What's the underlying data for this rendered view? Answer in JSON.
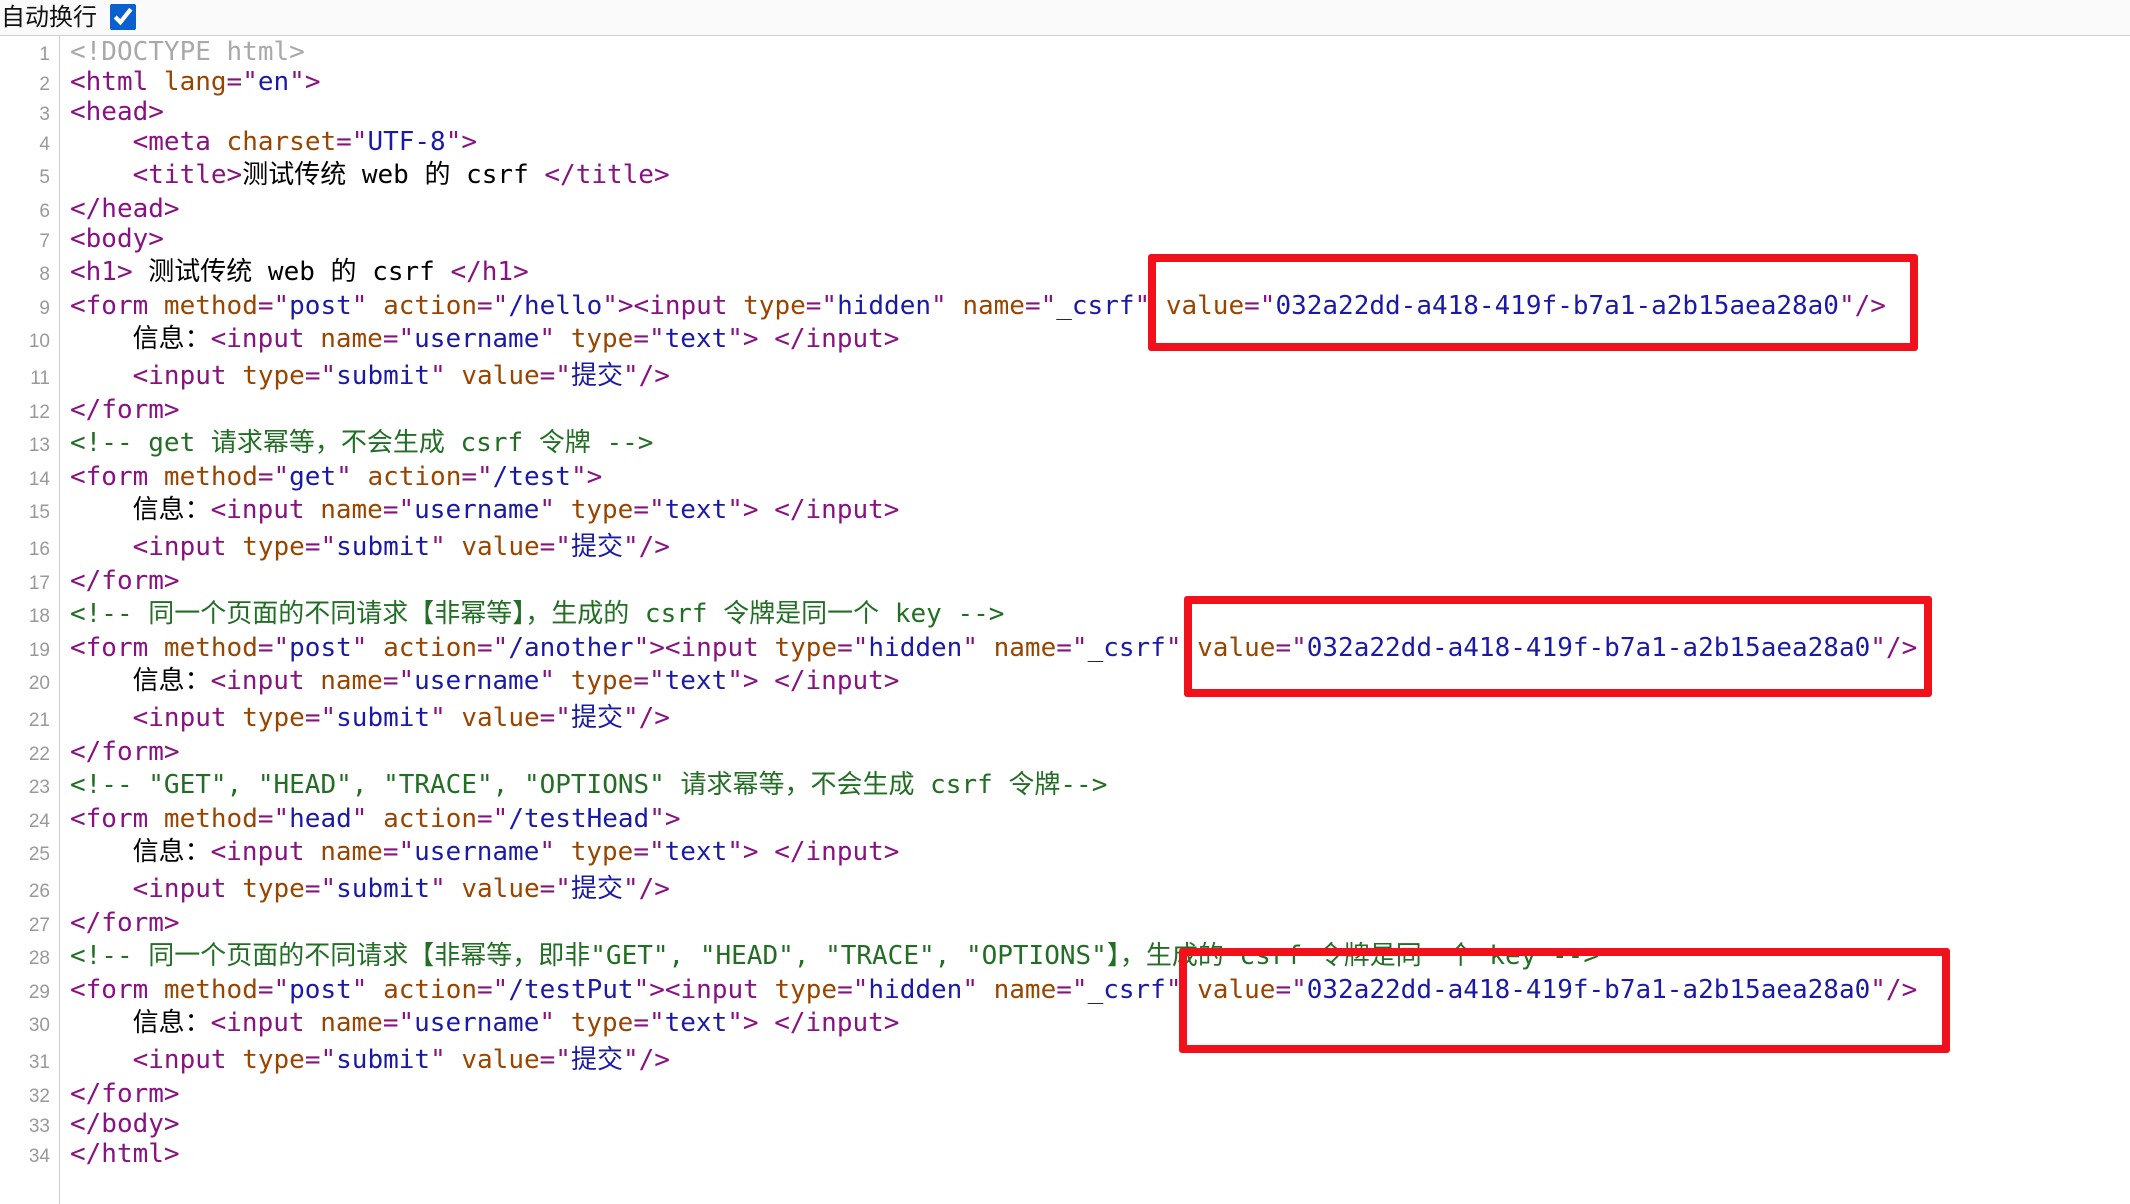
{
  "toolbar": {
    "line_wrap": {
      "label": "自动换行",
      "checked": true
    }
  },
  "source": {
    "lines": [
      {
        "n": 1,
        "text": "<!DOCTYPE html>"
      },
      {
        "n": 2,
        "text": "<html lang=\"en\">"
      },
      {
        "n": 3,
        "text": "<head>"
      },
      {
        "n": 4,
        "text": "    <meta charset=\"UTF-8\">"
      },
      {
        "n": 5,
        "text": "    <title>测试传统 web 的 csrf </title>"
      },
      {
        "n": 6,
        "text": "</head>"
      },
      {
        "n": 7,
        "text": "<body>"
      },
      {
        "n": 8,
        "text": "<h1> 测试传统 web 的 csrf </h1>"
      },
      {
        "n": 9,
        "text": "<form method=\"post\" action=\"/hello\"><input type=\"hidden\" name=\"_csrf\" value=\"032a22dd-a418-419f-b7a1-a2b15aea28a0\"/>"
      },
      {
        "n": 10,
        "text": "    信息：<input name=\"username\" type=\"text\"> </input>"
      },
      {
        "n": 11,
        "text": "    <input type=\"submit\" value=\"提交\"/>"
      },
      {
        "n": 12,
        "text": "</form>"
      },
      {
        "n": 13,
        "text": "<!-- get 请求幂等，不会生成 csrf 令牌 -->"
      },
      {
        "n": 14,
        "text": "<form method=\"get\" action=\"/test\">"
      },
      {
        "n": 15,
        "text": "    信息：<input name=\"username\" type=\"text\"> </input>"
      },
      {
        "n": 16,
        "text": "    <input type=\"submit\" value=\"提交\"/>"
      },
      {
        "n": 17,
        "text": "</form>"
      },
      {
        "n": 18,
        "text": "<!-- 同一个页面的不同请求【非幂等】，生成的 csrf 令牌是同一个 key -->"
      },
      {
        "n": 19,
        "text": "<form method=\"post\" action=\"/another\"><input type=\"hidden\" name=\"_csrf\" value=\"032a22dd-a418-419f-b7a1-a2b15aea28a0\"/>"
      },
      {
        "n": 20,
        "text": "    信息：<input name=\"username\" type=\"text\"> </input>"
      },
      {
        "n": 21,
        "text": "    <input type=\"submit\" value=\"提交\"/>"
      },
      {
        "n": 22,
        "text": "</form>"
      },
      {
        "n": 23,
        "text": "<!-- \"GET\", \"HEAD\", \"TRACE\", \"OPTIONS\" 请求幂等，不会生成 csrf 令牌-->"
      },
      {
        "n": 24,
        "text": "<form method=\"head\" action=\"/testHead\">"
      },
      {
        "n": 25,
        "text": "    信息：<input name=\"username\" type=\"text\"> </input>"
      },
      {
        "n": 26,
        "text": "    <input type=\"submit\" value=\"提交\"/>"
      },
      {
        "n": 27,
        "text": "</form>"
      },
      {
        "n": 28,
        "text": "<!-- 同一个页面的不同请求【非幂等，即非\"GET\", \"HEAD\", \"TRACE\", \"OPTIONS\"】，生成的 csrf 令牌是同一个 key -->"
      },
      {
        "n": 29,
        "text": "<form method=\"post\" action=\"/testPut\"><input type=\"hidden\" name=\"_csrf\" value=\"032a22dd-a418-419f-b7a1-a2b15aea28a0\"/>"
      },
      {
        "n": 30,
        "text": "    信息：<input name=\"username\" type=\"text\"> </input>"
      },
      {
        "n": 31,
        "text": "    <input type=\"submit\" value=\"提交\"/>"
      },
      {
        "n": 32,
        "text": "</form>"
      },
      {
        "n": 33,
        "text": "</body>"
      },
      {
        "n": 34,
        "text": "</html>"
      }
    ]
  },
  "syntax_colors": {
    "tag": "#881280",
    "attr": "#994500",
    "value": "#1a1aa6",
    "comment": "#236e25",
    "doctype": "#a9a9a9",
    "text": "#000000"
  },
  "highlight_color": "#f2111b"
}
